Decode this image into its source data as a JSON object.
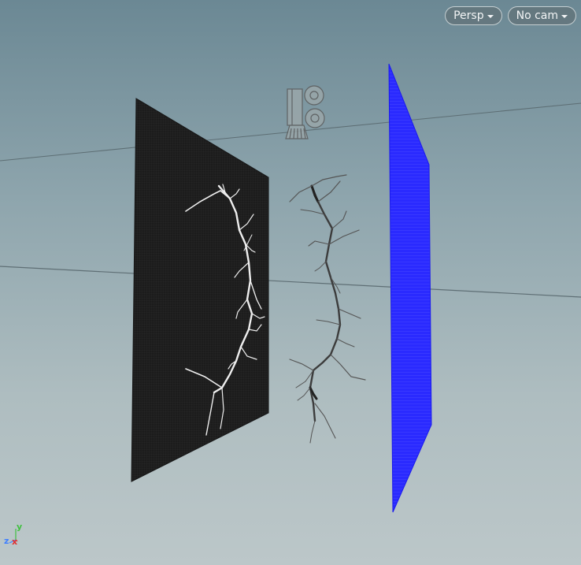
{
  "viewport": {
    "view_mode": {
      "label": "Persp",
      "icon": "chevron-down-icon"
    },
    "camera": {
      "label": "No cam",
      "icon": "chevron-down-icon"
    },
    "axes": {
      "y": "y",
      "z": "z",
      "x": "x"
    }
  },
  "colors": {
    "background_top": "#6b8894",
    "background_bottom": "#bcc7c9",
    "dark_plane": "#1e1e1e",
    "blue_plane": "#2424ff",
    "branch_white": "#f0f0f0",
    "branch_dark": "#3a3a3a",
    "axis_x": "#e03030",
    "axis_y": "#40c040",
    "axis_z": "#4080ff"
  }
}
